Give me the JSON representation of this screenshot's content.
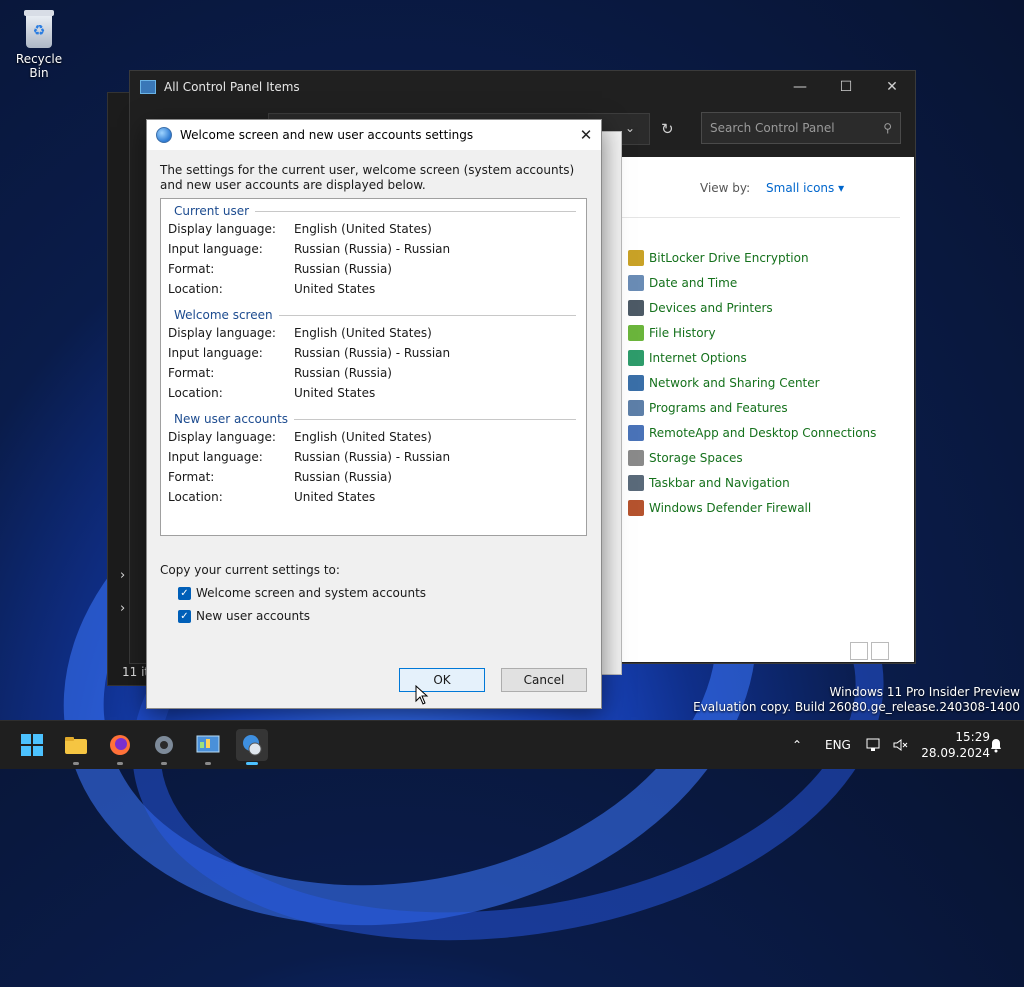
{
  "desktop": {
    "recycle_bin_label": "Recycle Bin",
    "watermark_line1": "Windows 11 Pro Insider Preview",
    "watermark_line2": "Evaluation copy. Build 26080.ge_release.240308-1400"
  },
  "control_panel": {
    "title": "All Control Panel Items",
    "search_placeholder": "Search Control Panel",
    "view_by_label": "View by:",
    "view_by_value": "Small icons",
    "items": [
      {
        "label": "BitLocker Drive Encryption",
        "color": "#c9a227"
      },
      {
        "label": "Date and Time",
        "color": "#6a8cb5"
      },
      {
        "label": "Devices and Printers",
        "color": "#4d5a66"
      },
      {
        "label": "File History",
        "color": "#6bb53c"
      },
      {
        "label": "Internet Options",
        "color": "#2e9c6b"
      },
      {
        "label": "Network and Sharing Center",
        "color": "#3a6fa8"
      },
      {
        "label": "Programs and Features",
        "color": "#5d7fa8"
      },
      {
        "label": "RemoteApp and Desktop Connections",
        "color": "#4a73b8"
      },
      {
        "label": "Storage Spaces",
        "color": "#8a8a8a"
      },
      {
        "label": "Taskbar and Navigation",
        "color": "#5a6a7a"
      },
      {
        "label": "Windows Defender Firewall",
        "color": "#b5532e"
      }
    ],
    "status_fragment": "11 it"
  },
  "dialog": {
    "title": "Welcome screen and new user accounts settings",
    "intro": "The settings for the current user, welcome screen (system accounts) and new user accounts are displayed below.",
    "sections": [
      {
        "heading": "Current user",
        "rows": [
          {
            "key": "Display language:",
            "value": "English (United States)"
          },
          {
            "key": "Input language:",
            "value": "Russian (Russia) - Russian"
          },
          {
            "key": "Format:",
            "value": "Russian (Russia)"
          },
          {
            "key": "Location:",
            "value": "United States"
          }
        ]
      },
      {
        "heading": "Welcome screen",
        "rows": [
          {
            "key": "Display language:",
            "value": "English (United States)"
          },
          {
            "key": "Input language:",
            "value": "Russian (Russia) - Russian"
          },
          {
            "key": "Format:",
            "value": "Russian (Russia)"
          },
          {
            "key": "Location:",
            "value": "United States"
          }
        ]
      },
      {
        "heading": "New user accounts",
        "rows": [
          {
            "key": "Display language:",
            "value": "English (United States)"
          },
          {
            "key": "Input language:",
            "value": "Russian (Russia) - Russian"
          },
          {
            "key": "Format:",
            "value": "Russian (Russia)"
          },
          {
            "key": "Location:",
            "value": "United States"
          }
        ]
      }
    ],
    "copy_label": "Copy your current settings to:",
    "checkbox_welcome": "Welcome screen and system accounts",
    "checkbox_new_users": "New user accounts",
    "ok_label": "OK",
    "cancel_label": "Cancel",
    "accent": "#005fb8"
  },
  "taskbar": {
    "language": "ENG",
    "time": "15:29",
    "date": "28.09.2024"
  }
}
